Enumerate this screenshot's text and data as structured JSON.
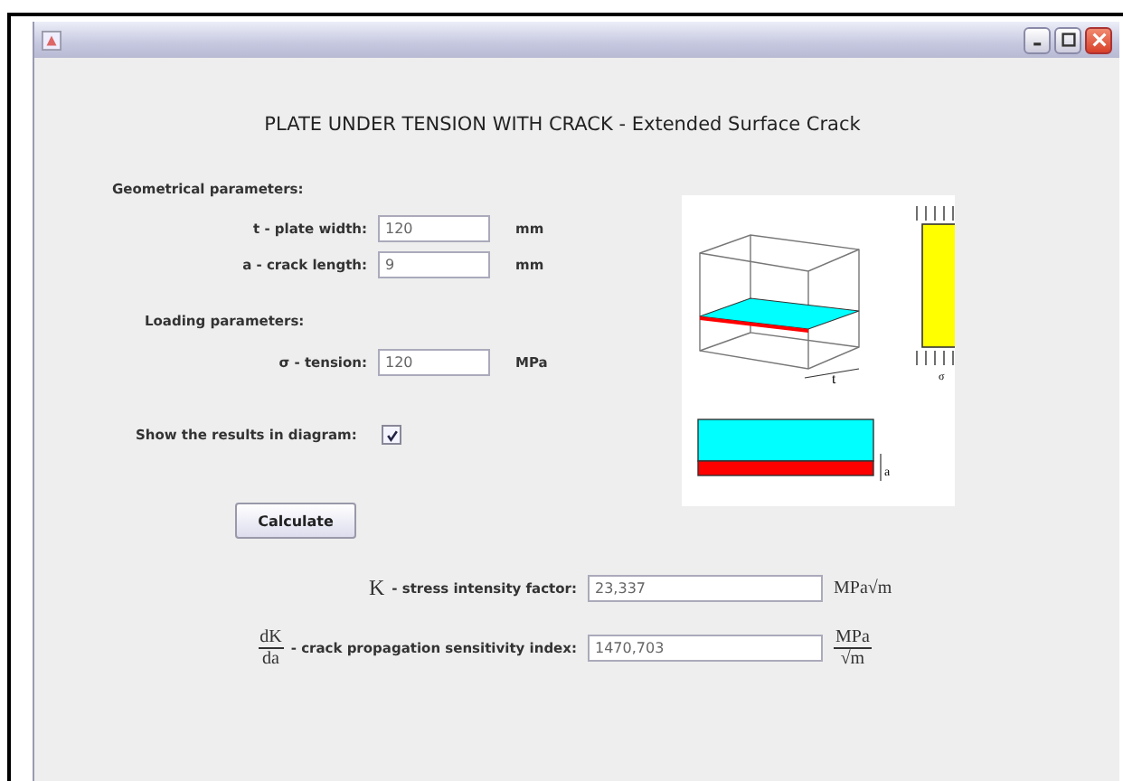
{
  "heading": "PLATE UNDER TENSION WITH CRACK - Extended Surface Crack",
  "geometry": {
    "title": "Geometrical parameters:",
    "fields": [
      {
        "label": "t - plate width:",
        "value": "120",
        "unit": "mm"
      },
      {
        "label": "a - crack length:",
        "value": "9",
        "unit": "mm"
      }
    ]
  },
  "loading": {
    "title": "Loading parameters:",
    "fields": [
      {
        "label": "σ - tension:",
        "value": "120",
        "unit": "MPa"
      }
    ]
  },
  "show_diagram": {
    "label": "Show the results in diagram:",
    "checked": true
  },
  "calculate_button": "Calculate",
  "diagram": {
    "width_label": "t",
    "stress_label": "σ",
    "depth_label": "a"
  },
  "results": [
    {
      "kind": "symbol",
      "symbol": "K",
      "label": "- stress intensity factor:",
      "value": "23,337",
      "unit": "MPa√m"
    },
    {
      "kind": "fraction",
      "numerator": "dK",
      "denominator": "da",
      "label": "- crack propagation sensitivity index:",
      "value": "1470,703",
      "unit_numerator": "MPa",
      "unit_denominator": "√m"
    }
  ]
}
